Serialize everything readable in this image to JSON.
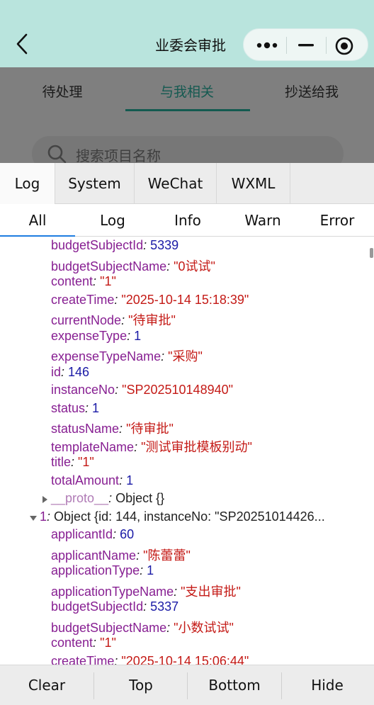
{
  "nav": {
    "title": "业委会审批"
  },
  "page": {
    "tabs": [
      "待处理",
      "与我相关",
      "抄送给我"
    ],
    "active_tab": 1,
    "search_placeholder": "搜索项目名称"
  },
  "vconsole": {
    "tabs": [
      "Log",
      "System",
      "WeChat",
      "WXML"
    ],
    "log_filters": [
      "All",
      "Log",
      "Info",
      "Warn",
      "Error"
    ],
    "footer": [
      "Clear",
      "Top",
      "Bottom",
      "Hide"
    ]
  },
  "log_lines": [
    {
      "kind": "kv",
      "key": "budgetSubjectId",
      "val": "5339",
      "type": "n"
    },
    {
      "kind": "kv",
      "key": "budgetSubjectName",
      "val": "\"0试试\"",
      "type": "s"
    },
    {
      "kind": "kv",
      "key": "content",
      "val": "\"1\"",
      "type": "s"
    },
    {
      "kind": "kv",
      "key": "createTime",
      "val": "\"2025-10-14 15:18:39\"",
      "type": "s"
    },
    {
      "kind": "kv",
      "key": "currentNode",
      "val": "\"待审批\"",
      "type": "s"
    },
    {
      "kind": "kv",
      "key": "expenseType",
      "val": "1",
      "type": "n"
    },
    {
      "kind": "kv",
      "key": "expenseTypeName",
      "val": "\"采购\"",
      "type": "s"
    },
    {
      "kind": "kv",
      "key": "id",
      "val": "146",
      "type": "n"
    },
    {
      "kind": "kv",
      "key": "instanceNo",
      "val": "\"SP202510148940\"",
      "type": "s"
    },
    {
      "kind": "kv",
      "key": "status",
      "val": "1",
      "type": "n"
    },
    {
      "kind": "kv",
      "key": "statusName",
      "val": "\"待审批\"",
      "type": "s"
    },
    {
      "kind": "kv",
      "key": "templateName",
      "val": "\"测试审批模板别动\"",
      "type": "s"
    },
    {
      "kind": "kv",
      "key": "title",
      "val": "\"1\"",
      "type": "s"
    },
    {
      "kind": "kv",
      "key": "totalAmount",
      "val": "1",
      "type": "n"
    },
    {
      "kind": "proto",
      "key": "__proto__",
      "val": "Object {}"
    },
    {
      "kind": "obj",
      "key": "1",
      "val": "Object {id: 144, instanceNo: \"SP20251014426..."
    },
    {
      "kind": "kv",
      "key": "applicantId",
      "val": "60",
      "type": "n"
    },
    {
      "kind": "kv",
      "key": "applicantName",
      "val": "\"陈蕾蕾\"",
      "type": "s"
    },
    {
      "kind": "kv",
      "key": "applicationType",
      "val": "1",
      "type": "n"
    },
    {
      "kind": "kv",
      "key": "applicationTypeName",
      "val": "\"支出审批\"",
      "type": "s"
    },
    {
      "kind": "kv",
      "key": "budgetSubjectId",
      "val": "5337",
      "type": "n"
    },
    {
      "kind": "kv",
      "key": "budgetSubjectName",
      "val": "\"小数试试\"",
      "type": "s"
    },
    {
      "kind": "kv",
      "key": "content",
      "val": "\"1\"",
      "type": "s"
    },
    {
      "kind": "kv",
      "key": "createTime",
      "val": "\"2025-10-14 15:06:44\"",
      "type": "s"
    }
  ]
}
